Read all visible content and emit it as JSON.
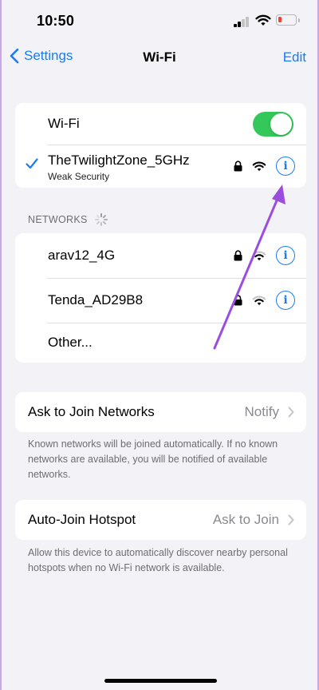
{
  "status": {
    "time": "10:50"
  },
  "nav": {
    "back_label": "Settings",
    "title": "Wi-Fi",
    "edit_label": "Edit"
  },
  "wifi": {
    "label": "Wi-Fi",
    "enabled": true
  },
  "current_network": {
    "name": "TheTwilightZone_5GHz",
    "subtitle": "Weak Security"
  },
  "networks_header": "NETWORKS",
  "networks": [
    {
      "name": "arav12_4G"
    },
    {
      "name": "Tenda_AD29B8"
    }
  ],
  "other_label": "Other...",
  "ask_to_join": {
    "label": "Ask to Join Networks",
    "value": "Notify",
    "footnote": "Known networks will be joined automatically. If no known networks are available, you will be notified of available networks."
  },
  "auto_join": {
    "label": "Auto-Join Hotspot",
    "value": "Ask to Join",
    "footnote": "Allow this device to automatically discover nearby personal hotspots when no Wi-Fi network is available."
  },
  "colors": {
    "accent": "#1a7cf5",
    "toggle_on": "#34c759",
    "annotation": "#9b4de0",
    "battery_low": "#ff3b30"
  }
}
